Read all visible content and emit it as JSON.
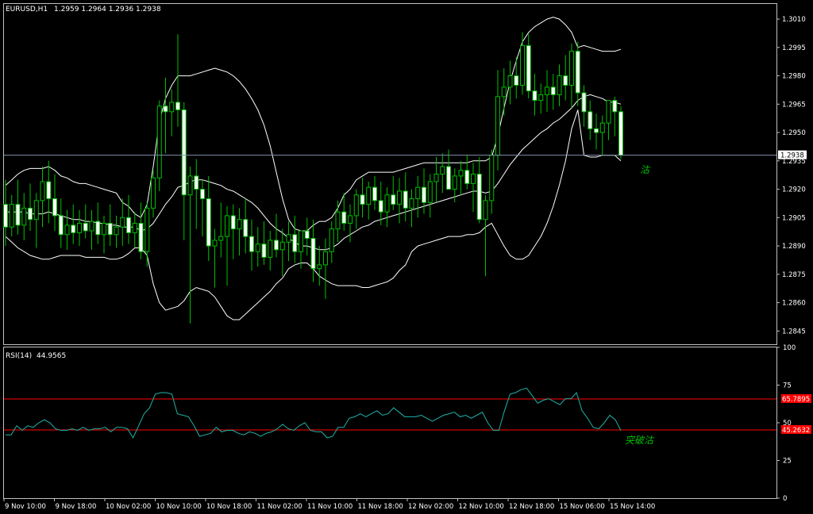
{
  "chart_data": [
    {
      "type": "candlestick",
      "symbol_header": "EURUSD,H1",
      "ohlc_header": "1.2959 1.2964 1.2936 1.2938",
      "ylim": [
        1.2838,
        1.3018
      ],
      "y_ticks": [
        "1.3010",
        "1.2995",
        "1.2980",
        "1.2965",
        "1.2950",
        "1.2935",
        "1.2920",
        "1.2905",
        "1.2890",
        "1.2875",
        "1.2860",
        "1.2845"
      ],
      "current_price_label": "1.2938",
      "current_price": 1.2938,
      "annotation": "沽",
      "x_tick_labels": [
        "9 Nov 10:00",
        "9 Nov 18:00",
        "10 Nov 02:00",
        "10 Nov 10:00",
        "10 Nov 18:00",
        "11 Nov 02:00",
        "11 Nov 10:00",
        "11 Nov 18:00",
        "12 Nov 02:00",
        "12 Nov 10:00",
        "12 Nov 18:00",
        "15 Nov 06:00",
        "15 Nov 14:00"
      ],
      "candles": [
        [
          1.2912,
          1.2925,
          1.289,
          1.29
        ],
        [
          1.29,
          1.2917,
          1.2895,
          1.2912
        ],
        [
          1.2912,
          1.2925,
          1.2896,
          1.2901
        ],
        [
          1.2901,
          1.2918,
          1.2893,
          1.291
        ],
        [
          1.291,
          1.2923,
          1.2898,
          1.2904
        ],
        [
          1.2904,
          1.2918,
          1.2889,
          1.2914
        ],
        [
          1.2914,
          1.2932,
          1.29,
          1.2924
        ],
        [
          1.2924,
          1.2935,
          1.2902,
          1.2915
        ],
        [
          1.2915,
          1.2928,
          1.2898,
          1.2906
        ],
        [
          1.2906,
          1.2915,
          1.2889,
          1.2896
        ],
        [
          1.2896,
          1.2909,
          1.2888,
          1.2901
        ],
        [
          1.2901,
          1.2912,
          1.2891,
          1.2897
        ],
        [
          1.2897,
          1.2909,
          1.289,
          1.2902
        ],
        [
          1.2902,
          1.2912,
          1.2894,
          1.2898
        ],
        [
          1.2898,
          1.2909,
          1.2888,
          1.2903
        ],
        [
          1.2903,
          1.2913,
          1.2891,
          1.2896
        ],
        [
          1.2896,
          1.2906,
          1.2886,
          1.2902
        ],
        [
          1.2902,
          1.2912,
          1.289,
          1.2896
        ],
        [
          1.2896,
          1.2906,
          1.2889,
          1.29
        ],
        [
          1.29,
          1.2915,
          1.289,
          1.2905
        ],
        [
          1.2905,
          1.2917,
          1.2891,
          1.2897
        ],
        [
          1.2897,
          1.2908,
          1.2889,
          1.2902
        ],
        [
          1.2902,
          1.2913,
          1.2883,
          1.2887
        ],
        [
          1.2887,
          1.2913,
          1.2879,
          1.291
        ],
        [
          1.291,
          1.293,
          1.2905,
          1.2926
        ],
        [
          1.2926,
          1.2967,
          1.2919,
          1.2964
        ],
        [
          1.2964,
          1.2979,
          1.2939,
          1.2961
        ],
        [
          1.2961,
          1.2973,
          1.2948,
          1.2966
        ],
        [
          1.2966,
          1.3002,
          1.2953,
          1.2962
        ],
        [
          1.2962,
          1.2966,
          1.2893,
          1.2917
        ],
        [
          1.2917,
          1.2932,
          1.2849,
          1.2927
        ],
        [
          1.2927,
          1.2936,
          1.2899,
          1.292
        ],
        [
          1.292,
          1.2925,
          1.2895,
          1.2915
        ],
        [
          1.2915,
          1.2927,
          1.2882,
          1.289
        ],
        [
          1.289,
          1.2899,
          1.2868,
          1.2893
        ],
        [
          1.2893,
          1.2913,
          1.2884,
          1.2895
        ],
        [
          1.2895,
          1.2911,
          1.2869,
          1.2906
        ],
        [
          1.2906,
          1.2912,
          1.2883,
          1.2899
        ],
        [
          1.2899,
          1.291,
          1.2885,
          1.2904
        ],
        [
          1.2904,
          1.2915,
          1.2886,
          1.2895
        ],
        [
          1.2895,
          1.2904,
          1.2877,
          1.2887
        ],
        [
          1.2887,
          1.29,
          1.2879,
          1.2891
        ],
        [
          1.2891,
          1.2903,
          1.288,
          1.2884
        ],
        [
          1.2884,
          1.2898,
          1.2877,
          1.2893
        ],
        [
          1.2893,
          1.2907,
          1.2884,
          1.2888
        ],
        [
          1.2888,
          1.2899,
          1.2874,
          1.2892
        ],
        [
          1.2892,
          1.2903,
          1.2882,
          1.2896
        ],
        [
          1.2896,
          1.2906,
          1.2881,
          1.2887
        ],
        [
          1.2887,
          1.2897,
          1.2878,
          1.2898
        ],
        [
          1.2898,
          1.2905,
          1.2885,
          1.2894
        ],
        [
          1.2894,
          1.2904,
          1.2871,
          1.2878
        ],
        [
          1.2878,
          1.289,
          1.2869,
          1.288
        ],
        [
          1.288,
          1.2894,
          1.2862,
          1.2887
        ],
        [
          1.2887,
          1.2903,
          1.2881,
          1.2899
        ],
        [
          1.2899,
          1.2914,
          1.2892,
          1.2908
        ],
        [
          1.2908,
          1.2918,
          1.2898,
          1.2902
        ],
        [
          1.2902,
          1.2912,
          1.2892,
          1.2906
        ],
        [
          1.2906,
          1.292,
          1.2899,
          1.2917
        ],
        [
          1.2917,
          1.2926,
          1.2905,
          1.2912
        ],
        [
          1.2912,
          1.2924,
          1.2904,
          1.2921
        ],
        [
          1.2921,
          1.2927,
          1.2909,
          1.2914
        ],
        [
          1.2914,
          1.2924,
          1.2901,
          1.2908
        ],
        [
          1.2908,
          1.2921,
          1.29,
          1.2917
        ],
        [
          1.2917,
          1.2927,
          1.2909,
          1.2912
        ],
        [
          1.2912,
          1.2926,
          1.2902,
          1.2919
        ],
        [
          1.2919,
          1.2929,
          1.2903,
          1.291
        ],
        [
          1.291,
          1.292,
          1.29,
          1.2915
        ],
        [
          1.2915,
          1.2927,
          1.2905,
          1.2921
        ],
        [
          1.2921,
          1.2931,
          1.2907,
          1.2913
        ],
        [
          1.2913,
          1.2928,
          1.2905,
          1.2924
        ],
        [
          1.2924,
          1.2937,
          1.2913,
          1.2928
        ],
        [
          1.2928,
          1.2939,
          1.2918,
          1.2932
        ],
        [
          1.2932,
          1.2941,
          1.292,
          1.292
        ],
        [
          1.292,
          1.2931,
          1.2913,
          1.2927
        ],
        [
          1.2927,
          1.2935,
          1.2917,
          1.293
        ],
        [
          1.293,
          1.2938,
          1.292,
          1.2923
        ],
        [
          1.2923,
          1.2934,
          1.2908,
          1.2928
        ],
        [
          1.2928,
          1.2937,
          1.2902,
          1.2904
        ],
        [
          1.2904,
          1.2917,
          1.2874,
          1.2914
        ],
        [
          1.2914,
          1.2941,
          1.2907,
          1.2938
        ],
        [
          1.2938,
          1.2983,
          1.293,
          1.2969
        ],
        [
          1.2969,
          1.2984,
          1.2959,
          1.2974
        ],
        [
          1.2974,
          1.2988,
          1.2965,
          1.298
        ],
        [
          1.298,
          1.299,
          1.2968,
          1.2975
        ],
        [
          1.2975,
          1.3003,
          1.297,
          1.2996
        ],
        [
          1.2996,
          1.3002,
          1.2968,
          1.2972
        ],
        [
          1.2972,
          1.2981,
          1.2959,
          1.2967
        ],
        [
          1.2967,
          1.2976,
          1.296,
          1.297
        ],
        [
          1.297,
          1.2983,
          1.2961,
          1.2974
        ],
        [
          1.2974,
          1.2981,
          1.2962,
          1.297
        ],
        [
          1.297,
          1.2986,
          1.2964,
          1.298
        ],
        [
          1.298,
          1.2991,
          1.2967,
          1.2975
        ],
        [
          1.2975,
          1.2997,
          1.2963,
          1.2993
        ],
        [
          1.2993,
          1.2998,
          1.2964,
          1.2971
        ],
        [
          1.2971,
          1.2975,
          1.2953,
          1.2961
        ],
        [
          1.2961,
          1.2967,
          1.2946,
          1.2952
        ],
        [
          1.2952,
          1.296,
          1.2941,
          1.295
        ],
        [
          1.295,
          1.2959,
          1.2938,
          1.2955
        ],
        [
          1.2955,
          1.2966,
          1.2946,
          1.2967
        ],
        [
          1.2967,
          1.2969,
          1.2948,
          1.2961
        ],
        [
          1.2961,
          1.2964,
          1.2936,
          1.2938
        ]
      ],
      "bands": {
        "upper": [
          1.2922,
          1.2925,
          1.2928,
          1.293,
          1.2931,
          1.2931,
          1.2931,
          1.2932,
          1.293,
          1.2927,
          1.2926,
          1.2924,
          1.2923,
          1.2923,
          1.2922,
          1.2921,
          1.292,
          1.2919,
          1.2918,
          1.2913,
          1.2911,
          1.2907,
          1.2905,
          1.2912,
          1.2932,
          1.2956,
          1.2968,
          1.2975,
          1.298,
          1.298,
          1.298,
          1.2981,
          1.2982,
          1.2983,
          1.2984,
          1.2983,
          1.2982,
          1.298,
          1.2977,
          1.2973,
          1.2968,
          1.2962,
          1.2954,
          1.2943,
          1.2929,
          1.2915,
          1.2904,
          1.2899,
          1.2898,
          1.2898,
          1.2901,
          1.2903,
          1.2903,
          1.2905,
          1.291,
          1.2917,
          1.292,
          1.2925,
          1.2927,
          1.2929,
          1.2929,
          1.2929,
          1.2929,
          1.2929,
          1.293,
          1.2931,
          1.2932,
          1.2933,
          1.2934,
          1.2934,
          1.2934,
          1.2934,
          1.2934,
          1.2934,
          1.2934,
          1.2934,
          1.2935,
          1.2935,
          1.2935,
          1.2937,
          1.2948,
          1.2963,
          1.2977,
          1.2988,
          1.2998,
          1.3003,
          1.3006,
          1.3008,
          1.301,
          1.3011,
          1.301,
          1.3007,
          1.3003,
          1.2995,
          1.2996,
          1.2995,
          1.2994,
          1.2993,
          1.2993,
          1.2993,
          1.2994
        ],
        "middle": [
          1.2908,
          1.2908,
          1.2908,
          1.2908,
          1.2907,
          1.2907,
          1.2907,
          1.2908,
          1.2907,
          1.2906,
          1.2905,
          1.2904,
          1.2904,
          1.2903,
          1.2903,
          1.2902,
          1.2902,
          1.2901,
          1.2901,
          1.29,
          1.29,
          1.29,
          1.2898,
          1.2899,
          1.2902,
          1.2907,
          1.2912,
          1.2916,
          1.2921,
          1.2922,
          1.2924,
          1.2925,
          1.2925,
          1.2924,
          1.2923,
          1.2922,
          1.292,
          1.2919,
          1.2917,
          1.2915,
          1.2913,
          1.291,
          1.2906,
          1.2902,
          1.2899,
          1.2897,
          1.2894,
          1.2892,
          1.289,
          1.289,
          1.2889,
          1.2888,
          1.2888,
          1.2889,
          1.2891,
          1.2894,
          1.2896,
          1.2898,
          1.29,
          1.2901,
          1.2903,
          1.2904,
          1.2905,
          1.2906,
          1.2907,
          1.2908,
          1.2909,
          1.291,
          1.2911,
          1.2912,
          1.2913,
          1.2914,
          1.2915,
          1.2916,
          1.2917,
          1.2918,
          1.2919,
          1.2919,
          1.2918,
          1.2919,
          1.2923,
          1.2928,
          1.2933,
          1.2937,
          1.2941,
          1.2944,
          1.2947,
          1.295,
          1.2952,
          1.2955,
          1.2957,
          1.296,
          1.2963,
          1.2967,
          1.2969,
          1.297,
          1.2969,
          1.2968,
          1.2966,
          1.2966,
          1.2965
        ],
        "lower": [
          1.2895,
          1.2892,
          1.2889,
          1.2887,
          1.2885,
          1.2884,
          1.2883,
          1.2883,
          1.2884,
          1.2885,
          1.2885,
          1.2885,
          1.2885,
          1.2884,
          1.2884,
          1.2884,
          1.2884,
          1.2883,
          1.2883,
          1.2884,
          1.2886,
          1.2889,
          1.2889,
          1.2885,
          1.287,
          1.286,
          1.2856,
          1.2857,
          1.2858,
          1.2861,
          1.2866,
          1.2868,
          1.2867,
          1.2866,
          1.2863,
          1.2858,
          1.2853,
          1.2851,
          1.2851,
          1.2854,
          1.2857,
          1.286,
          1.2863,
          1.2866,
          1.287,
          1.2873,
          1.2878,
          1.288,
          1.2881,
          1.2881,
          1.2878,
          1.2874,
          1.2872,
          1.287,
          1.2869,
          1.2869,
          1.2869,
          1.2869,
          1.2868,
          1.2868,
          1.2869,
          1.287,
          1.2871,
          1.2873,
          1.2877,
          1.288,
          1.2887,
          1.289,
          1.2891,
          1.2892,
          1.2893,
          1.2894,
          1.2895,
          1.2895,
          1.2895,
          1.2896,
          1.2896,
          1.2897,
          1.29,
          1.2902,
          1.2896,
          1.289,
          1.2885,
          1.2883,
          1.2883,
          1.2885,
          1.289,
          1.2895,
          1.2902,
          1.2911,
          1.2922,
          1.2935,
          1.2952,
          1.2962,
          1.2938,
          1.2937,
          1.2937,
          1.2938,
          1.2938,
          1.2938,
          1.2935
        ]
      }
    },
    {
      "type": "line",
      "indicator_label": "RSI(14)",
      "indicator_value": "44.9565",
      "ylim": [
        0,
        100
      ],
      "y_ticks": [
        "100",
        "75",
        "50",
        "25",
        "0"
      ],
      "level_high_label": "65.7895",
      "level_high": 65.7895,
      "level_low_label": "45.2632",
      "level_low": 45.2632,
      "annotation": "突破沽",
      "series": [
        {
          "values": [
            42,
            42,
            48,
            45,
            48,
            47,
            50,
            52,
            50,
            46,
            45,
            45,
            46,
            45,
            47,
            45,
            46,
            46,
            47,
            44,
            47,
            47,
            46,
            40,
            48,
            56,
            60,
            69,
            70,
            70,
            69,
            56,
            55,
            54,
            48,
            41,
            42,
            43,
            47,
            44,
            45,
            45,
            43,
            42,
            44,
            43,
            41,
            43,
            44,
            46,
            49,
            46,
            45,
            48,
            50,
            45,
            44,
            44,
            40,
            41,
            47,
            47,
            53,
            54,
            56,
            54,
            56,
            58,
            55,
            56,
            60,
            57,
            54,
            54,
            54,
            55,
            53,
            51,
            53,
            55,
            56,
            57,
            54,
            55,
            53,
            55,
            57,
            50,
            45,
            45,
            58,
            69,
            70,
            72,
            73,
            68,
            63,
            65,
            66,
            64,
            62,
            66,
            66,
            70,
            58,
            53,
            47,
            46,
            50,
            55,
            52,
            44.96
          ]
        }
      ]
    }
  ]
}
